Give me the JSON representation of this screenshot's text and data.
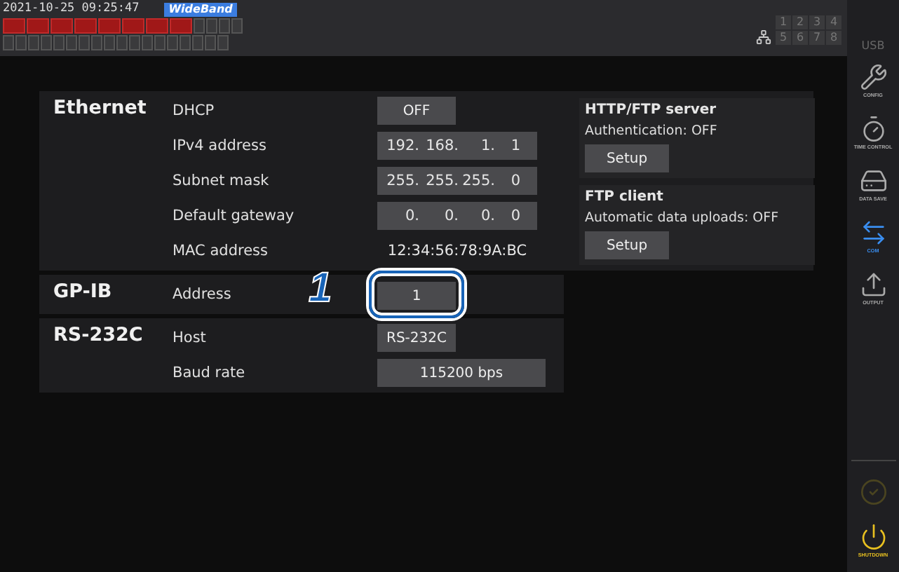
{
  "status_bar": {
    "datetime": "2021-10-25  09:25:47",
    "mode_badge": "WideBand",
    "channel_indicators": [
      {
        "active": true
      },
      {
        "active": true
      },
      {
        "active": true
      },
      {
        "active": true
      },
      {
        "active": true
      },
      {
        "active": true
      },
      {
        "active": true
      },
      {
        "active": true
      },
      {
        "active": false
      },
      {
        "active": false
      },
      {
        "active": false
      },
      {
        "active": false
      }
    ],
    "ports": [
      "1",
      "2",
      "3",
      "4",
      "5",
      "6",
      "7",
      "8"
    ],
    "usb": "USB"
  },
  "sidebar": {
    "items": [
      {
        "kind": "config",
        "label": "CONFIG",
        "selected": false,
        "disabled": false
      },
      {
        "kind": "time",
        "label": "TIME CONTROL",
        "selected": false,
        "disabled": false
      },
      {
        "kind": "save",
        "label": "DATA SAVE",
        "selected": false,
        "disabled": false
      },
      {
        "kind": "com",
        "label": "COM",
        "selected": true,
        "disabled": false
      },
      {
        "kind": "output",
        "label": "OUTPUT",
        "selected": false,
        "disabled": false
      }
    ],
    "bottom_items": [
      {
        "kind": "check",
        "disabled": true
      },
      {
        "kind": "shutdown",
        "label": "SHUTDOWN",
        "disabled": false
      }
    ]
  },
  "ethernet": {
    "title": "Ethernet",
    "rows": [
      {
        "kind": "button",
        "label": "DHCP",
        "value": "OFF"
      },
      {
        "kind": "ip",
        "label": "IPv4 address",
        "octets": [
          "192.",
          "168.",
          "1.",
          "1"
        ]
      },
      {
        "kind": "ip",
        "label": "Subnet mask",
        "octets": [
          "255.",
          "255.",
          "255.",
          "0"
        ]
      },
      {
        "kind": "ip",
        "label": "Default gateway",
        "octets": [
          "0.",
          "0.",
          "0.",
          "0"
        ]
      },
      {
        "kind": "text",
        "label": "MAC address",
        "value": "12:34:56:78:9A:BC"
      }
    ],
    "servers": [
      {
        "title": "HTTP/FTP server",
        "status": "Authentication: OFF",
        "button": "Setup"
      },
      {
        "title": "FTP client",
        "status": "Automatic data uploads: OFF",
        "button": "Setup"
      }
    ]
  },
  "gpib": {
    "title": "GP-IB",
    "label": "Address",
    "value": "1",
    "highlighted": true,
    "callout": "1"
  },
  "rs232c": {
    "title": "RS-232C",
    "rows": [
      {
        "kind": "short",
        "label": "Host",
        "value": "RS-232C"
      },
      {
        "kind": "wide",
        "label": "Baud rate",
        "value": "115200 bps"
      }
    ]
  }
}
